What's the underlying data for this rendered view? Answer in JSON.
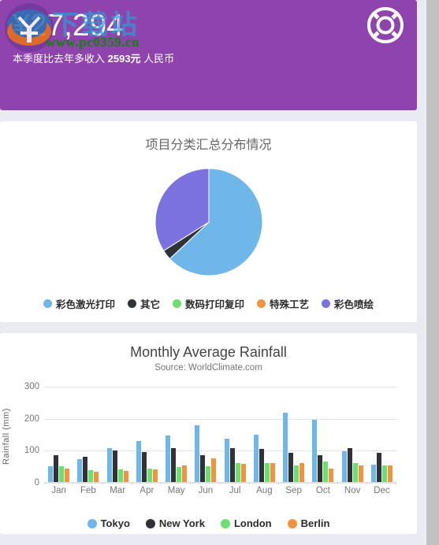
{
  "header": {
    "amount": "¥27,294",
    "subtitle_prefix": "本季度比去年多收入 ",
    "subtitle_strong": "2593元",
    "subtitle_suffix": " 人民币",
    "icon": "lifebuoy-icon",
    "background_color": "#8f44ad",
    "watermark_url": "www.pc0359.cn",
    "watermark_cn": "下载站"
  },
  "pie_card": {
    "title": "项目分类汇总分布情况"
  },
  "bar_card": {
    "title": "Monthly Average Rainfall",
    "subtitle": "Source: WorldClimate.com"
  },
  "page": {
    "background_color": "#e8ebf2",
    "card_background": "#ffffff",
    "scrollbar_color": "#c2c2c2"
  },
  "chart_data": [
    {
      "type": "pie",
      "title": "项目分类汇总分布情况",
      "labels": [
        "彩色激光打印",
        "其它",
        "数码打印复印",
        "特殊工艺",
        "彩色喷绘"
      ],
      "values": [
        63,
        3,
        0,
        0,
        34
      ],
      "colors": [
        "#6fb7e9",
        "#2f3337",
        "#6ce06c",
        "#ef9440",
        "#7b72e0"
      ],
      "legend_position": "bottom"
    },
    {
      "type": "bar",
      "title": "Monthly Average Rainfall",
      "subtitle": "Source: WorldClimate.com",
      "xlabel": "",
      "ylabel": "Rainfall (mm)",
      "ylim": [
        0,
        300
      ],
      "yticks": [
        0,
        100,
        200,
        300
      ],
      "grid": true,
      "legend_position": "bottom",
      "categories": [
        "Jan",
        "Feb",
        "Mar",
        "Apr",
        "May",
        "Jun",
        "Jul",
        "Aug",
        "Sep",
        "Oct",
        "Nov",
        "Dec"
      ],
      "series": [
        {
          "name": "Tokyo",
          "color": "#6fb7e9",
          "values": [
            49,
            72,
            106,
            129,
            144,
            176,
            135,
            148,
            216,
            194,
            95,
            54
          ]
        },
        {
          "name": "New York",
          "color": "#2f3337",
          "values": [
            83,
            78,
            98,
            93,
            106,
            84,
            105,
            104,
            91,
            83,
            106,
            92
          ]
        },
        {
          "name": "London",
          "color": "#6ce06c",
          "values": [
            48,
            38,
            39,
            41,
            47,
            48,
            59,
            59,
            52,
            65,
            59,
            51
          ]
        },
        {
          "name": "Berlin",
          "color": "#ef9440",
          "values": [
            42,
            33,
            34,
            39,
            52,
            75,
            57,
            60,
            59,
            42,
            51,
            52
          ]
        }
      ]
    }
  ]
}
